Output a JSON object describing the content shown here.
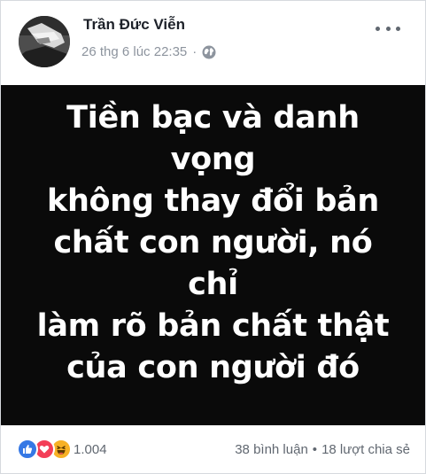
{
  "post": {
    "author": "Trần Đức Viễn",
    "timestamp": "26 thg 6 lúc 22:35",
    "separator": "·",
    "privacy_icon": "globe-icon",
    "more_icon": "more-options-icon"
  },
  "image": {
    "background": "#0a0a0a",
    "text_color": "#ffffff",
    "lines": [
      "Tiền bạc và danh vọng",
      "không thay đổi bản",
      "chất con người, nó chỉ",
      "làm rõ bản chất thật",
      "của con người đó"
    ]
  },
  "footer": {
    "reaction_icons": [
      "like-icon",
      "love-icon",
      "haha-icon"
    ],
    "reaction_count": "1.004",
    "comments": "38 bình luận",
    "separator": "•",
    "shares": "18 lượt chia sẻ"
  },
  "colors": {
    "like": "#3578e5",
    "love": "#f33e58",
    "haha": "#f7b125",
    "meta_text": "#8d949e"
  }
}
